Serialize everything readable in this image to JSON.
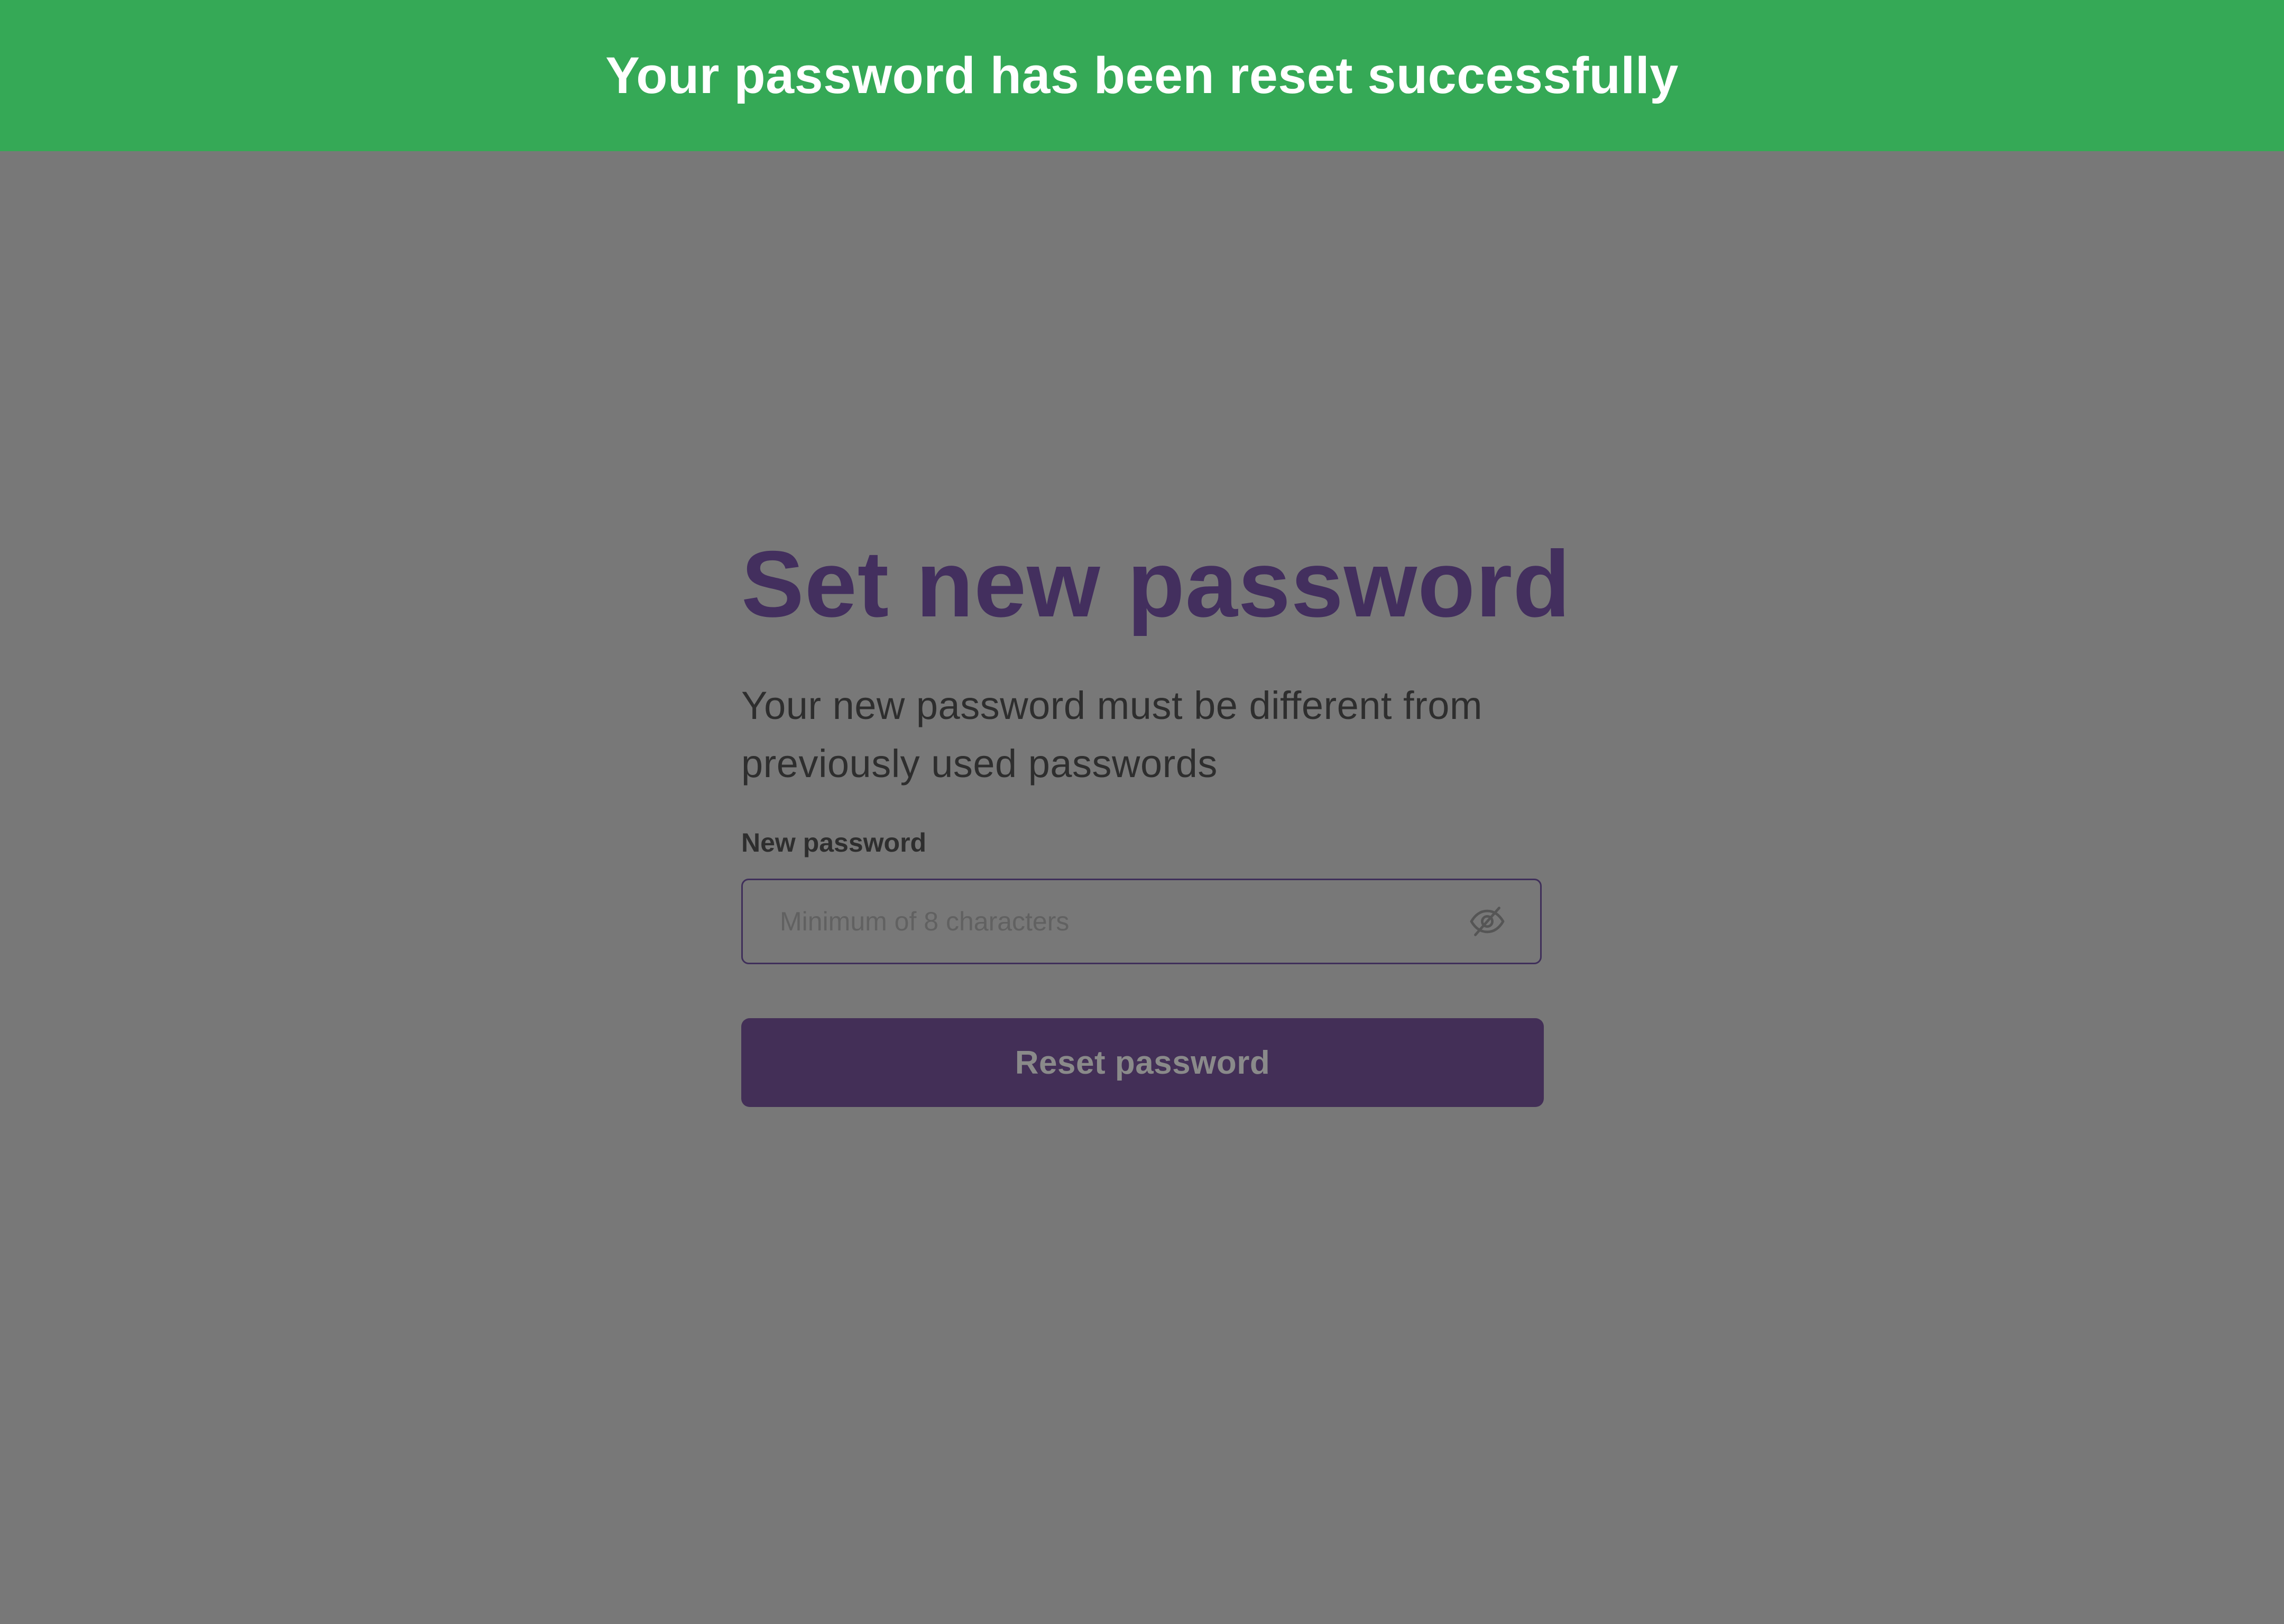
{
  "toast": {
    "message": "Your password has been reset successfully",
    "color": "#35a956"
  },
  "form": {
    "title": "Set new password",
    "subtitle": "Your new password must be different from previously used passwords",
    "field_label": "New password",
    "password_placeholder": "Minimum of 8 characters",
    "password_value": "",
    "toggle_icon": "eye-off-icon",
    "submit_label": "Reset password",
    "accent_color": "#432f5e"
  },
  "overlay": {
    "color": "#787878"
  }
}
